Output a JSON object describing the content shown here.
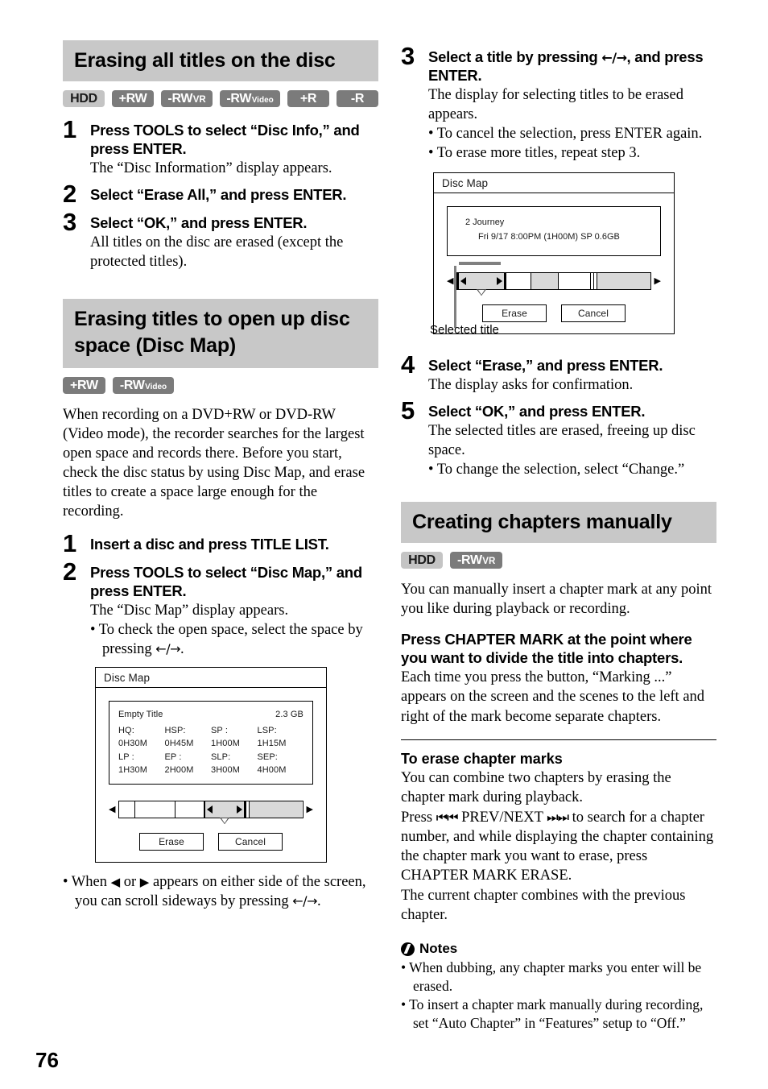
{
  "page": {
    "number": "76"
  },
  "left_column": {
    "section1": {
      "heading": "Erasing all titles on the disc",
      "badges": [
        {
          "main": "HDD",
          "sub": "",
          "style": "light"
        },
        {
          "main": "+RW",
          "sub": "",
          "style": "dark"
        },
        {
          "main": "-RW",
          "sub": "VR",
          "style": "dark"
        },
        {
          "main": "-RW",
          "sub": "Video",
          "style": "dark"
        },
        {
          "main": "+R",
          "sub": "",
          "style": "dark"
        },
        {
          "main": "-R",
          "sub": "",
          "style": "dark"
        }
      ],
      "steps": [
        {
          "num": "1",
          "title": "Press TOOLS to select “Disc Info,” and press ENTER.",
          "body": "The “Disc Information” display appears."
        },
        {
          "num": "2",
          "title": "Select “Erase All,” and press ENTER.",
          "body": ""
        },
        {
          "num": "3",
          "title": "Select “OK,” and press ENTER.",
          "body": "All titles on the disc are erased (except the protected titles)."
        }
      ]
    },
    "section2": {
      "heading": "Erasing titles to open up disc space (Disc Map)",
      "badges": [
        {
          "main": "+RW",
          "sub": "",
          "style": "dark"
        },
        {
          "main": "-RW",
          "sub": "Video",
          "style": "dark"
        }
      ],
      "intro": "When recording on a DVD+RW or DVD-RW (Video mode), the recorder searches for the largest open space and records there. Before you start, check the disc status by using Disc Map, and erase titles to create a space large enough for the recording.",
      "steps": [
        {
          "num": "1",
          "title": "Insert a disc and press TITLE LIST."
        },
        {
          "num": "2",
          "title": "Press TOOLS to select “Disc Map,” and press ENTER."
        }
      ],
      "step2_body": "The “Disc Map” display appears.",
      "step2_bullet_pre": "• To check the open space, select the space by pressing ",
      "step2_bullet_arrows": "←/→",
      "step2_bullet_post": ".",
      "disc_map": {
        "title": "Disc Map",
        "info_title": "Empty Title",
        "info_size": "2.3 GB",
        "modes_row1": [
          "HQ: 0H30M",
          "HSP: 0H45M",
          "SP  : 1H00M",
          "LSP: 1H15M"
        ],
        "modes_row2": [
          "LP : 1H30M",
          "EP  : 2H00M",
          "SLP: 3H00M",
          "SEP: 4H00M"
        ],
        "buttons": [
          "Erase",
          "Cancel"
        ],
        "left_arrow": "◀",
        "right_arrow": "▶"
      },
      "closing_bullet_a": "• When ",
      "closing_bullet_tri_l": "◀",
      "closing_bullet_b": " or ",
      "closing_bullet_tri_r": "▶",
      "closing_bullet_c": " appears on either side of the screen, you can scroll sideways by pressing ",
      "closing_bullet_arrows": "←/→",
      "closing_bullet_d": "."
    }
  },
  "right_column": {
    "steps": [
      {
        "num": "3",
        "title_pre": "Select a title by pressing ",
        "title_arrows": "←/→",
        "title_post": ", and press ENTER.",
        "body": "The display for selecting titles to be erased appears.",
        "bullets": [
          "• To cancel the selection, press ENTER again.",
          "• To erase more titles, repeat step 3."
        ]
      },
      {
        "num": "4",
        "title": "Select “Erase,” and press ENTER.",
        "body": "The display asks for confirmation.",
        "bullets": []
      },
      {
        "num": "5",
        "title": "Select “OK,” and press ENTER.",
        "body": "The selected titles are erased, freeing up disc space.",
        "bullets": [
          "• To change the selection, select “Change.”"
        ]
      }
    ],
    "disc_map": {
      "title": "Disc Map",
      "info_title": "2 Journey",
      "info_detail": "Fri  9/17  8:00PM (1H00M)    SP   0.6GB",
      "buttons": [
        "Erase",
        "Cancel"
      ],
      "left_arrow": "◀",
      "right_arrow": "▶",
      "caption": "Selected title"
    },
    "section3": {
      "heading": "Creating chapters manually",
      "badges": [
        {
          "main": "HDD",
          "sub": "",
          "style": "light"
        },
        {
          "main": "-RW",
          "sub": "VR",
          "style": "dark"
        }
      ],
      "intro": "You can manually insert a chapter mark at any point you like during playback or recording.",
      "instruction_head": "Press CHAPTER MARK at the point where you want to divide the title into chapters.",
      "instruction_body": "Each time you press the button, “Marking ...” appears on the screen and the scenes to the left and right of the mark become separate chapters.",
      "erase_head": "To erase chapter marks",
      "erase_body_1": "You can combine two chapters by erasing the chapter mark during playback.",
      "erase_body_2_pre": "Press ",
      "erase_body_2_prev": "⏮⏮",
      "erase_body_2_mid": "  PREV/NEXT  ",
      "erase_body_2_next": "⏭⏭",
      "erase_body_2_post": " to search for a chapter number, and while displaying the chapter containing the chapter mark you want to erase, press CHAPTER MARK ERASE.",
      "erase_body_3": "The current chapter combines with the previous chapter.",
      "notes_label": "Notes",
      "notes": [
        "• When dubbing, any chapter marks you enter will be erased.",
        "• To insert a chapter mark manually during recording, set “Auto Chapter” in “Features” setup to “Off.”"
      ]
    }
  }
}
